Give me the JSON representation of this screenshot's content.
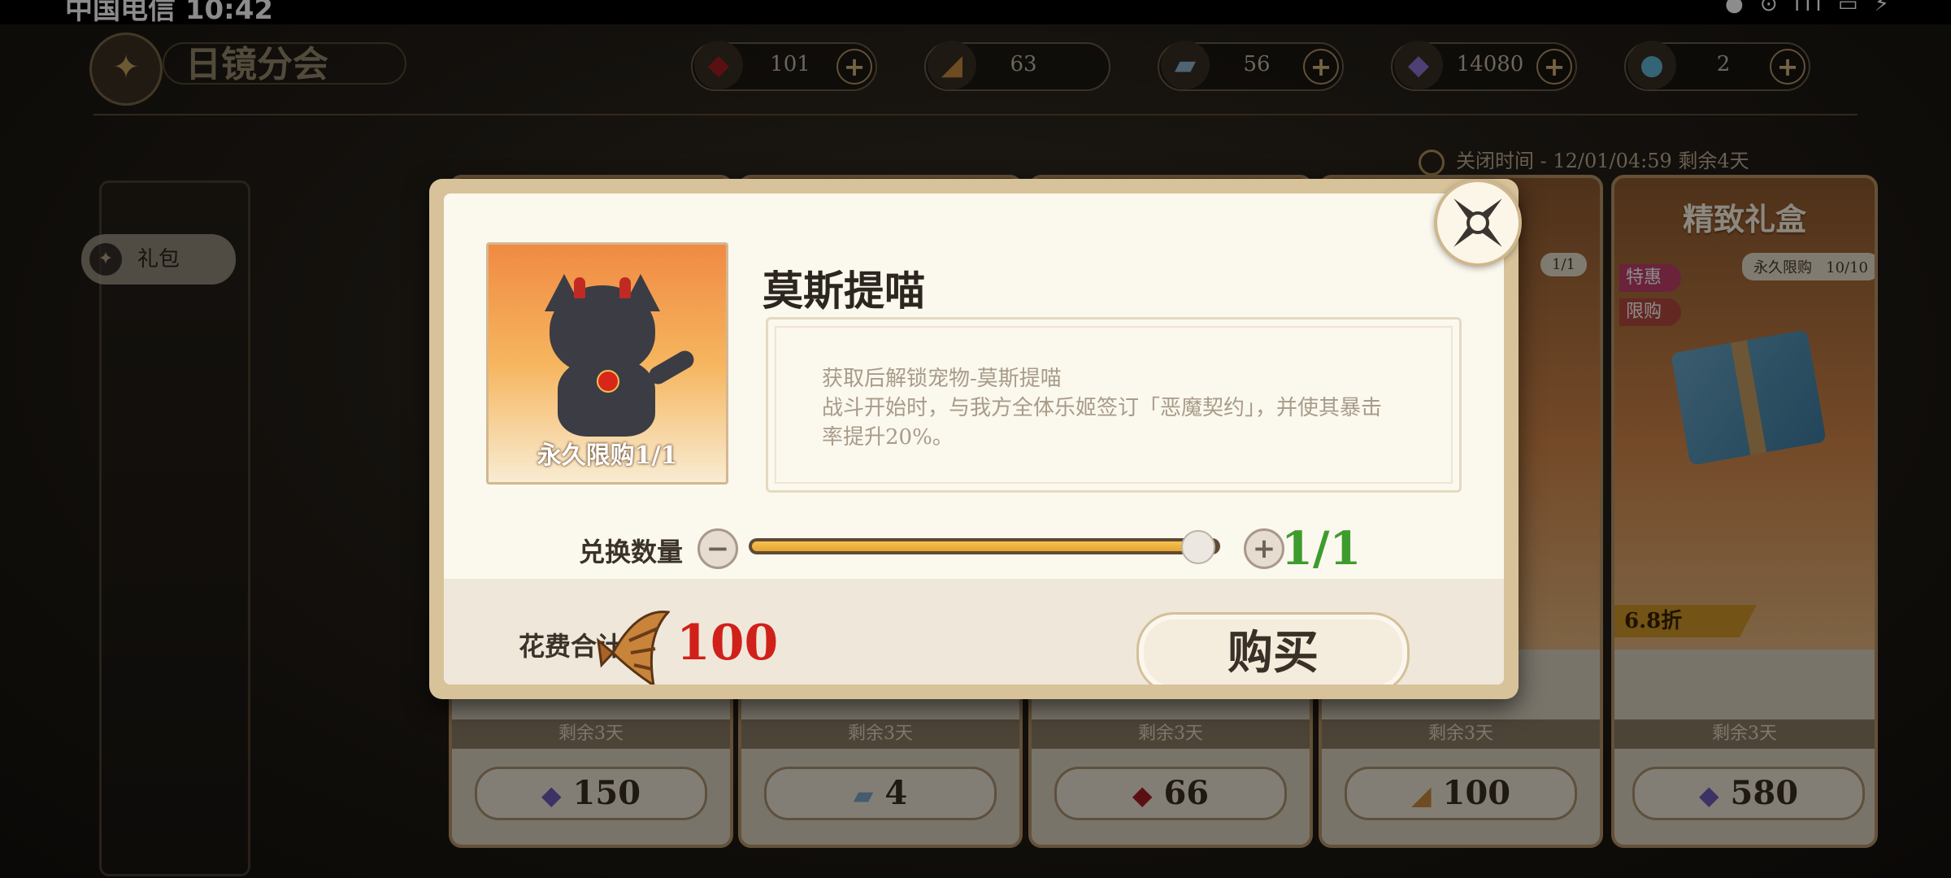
{
  "status_bar": {
    "carrier_time": "中国电信 10:42",
    "indicators": "● ⊙ ıll ▭ ⚡"
  },
  "header": {
    "title": "日镜分会",
    "emblem_icon": "crest-icon"
  },
  "currencies": [
    {
      "icon": "red-bag-icon",
      "value": "101",
      "has_plus": true
    },
    {
      "icon": "fish-coin-icon",
      "value": "63",
      "has_plus": false
    },
    {
      "icon": "ticket-icon",
      "value": "56",
      "has_plus": true
    },
    {
      "icon": "purple-gem-icon",
      "value": "14080",
      "has_plus": true
    },
    {
      "icon": "blue-pet-icon",
      "value": "2",
      "has_plus": true
    }
  ],
  "close_time": "关闭时间 - 12/01/04:59 剩余4天",
  "sidebar": {
    "tab_label": "礼包"
  },
  "cards": [
    {
      "remain": "剩余3天",
      "price": "150",
      "price_icon": "purple-gem-icon"
    },
    {
      "remain": "剩余3天",
      "price": "4",
      "price_icon": "ticket-icon"
    },
    {
      "remain": "剩余3天",
      "price": "66",
      "price_icon": "red-bag-icon"
    },
    {
      "remain": "剩余3天",
      "price": "100",
      "price_icon": "fish-coin-icon",
      "limit": "1/1"
    },
    {
      "remain": "剩余3天",
      "price": "580",
      "price_icon": "purple-gem-icon",
      "title": "精致礼盒",
      "limit_label": "永久限购",
      "limit": "10/10",
      "tags": [
        "特惠",
        "限购"
      ],
      "discount": "6.8折"
    }
  ],
  "modal": {
    "item_name": "莫斯提喵",
    "item_limit": "永久限购1/1",
    "desc_line1": "获取后解锁宠物-莫斯提喵",
    "desc_line2": "战斗开始时，与我方全体乐姬签订「恶魔契约」，并使其暴击",
    "desc_line3": "率提升20%。",
    "quantity_label": "兑换数量",
    "quantity_value": "1/1",
    "quantity_fraction": 1.0,
    "cost_label": "花费合计",
    "cost_value": "100",
    "cost_icon": "fish-coin-icon",
    "buy_label": "购买",
    "colors": {
      "cost": "#d0201a",
      "quantity": "#3e9b2d",
      "slider": "#f2b641"
    }
  }
}
